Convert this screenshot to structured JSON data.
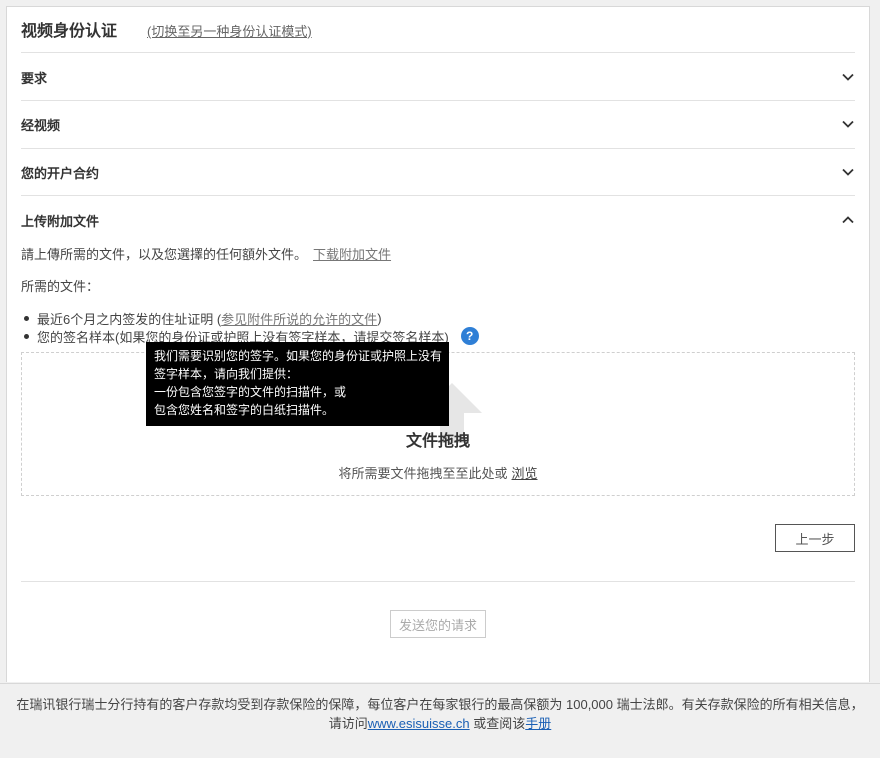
{
  "header": {
    "title": "视频身份认证",
    "switch_link": "(切换至另一种身份认证模式)"
  },
  "sections": [
    {
      "label": "要求",
      "state": "collapsed"
    },
    {
      "label": "经视频",
      "state": "collapsed"
    },
    {
      "label": "您的开户合约",
      "state": "collapsed"
    },
    {
      "label": "上传附加文件",
      "state": "expanded"
    }
  ],
  "upload": {
    "intro": "請上傳所需的文件，以及您選擇的任何額外文件。",
    "download_link": "下载附加文件",
    "required_label": "所需的文件：",
    "item1_text": "最近6个月之内签发的住址证明 (",
    "item1_link": "参见附件所说的允许的文件",
    "item1_close": ")",
    "item2_text": "您的签名样本(如果您的身份证或护照上没有签字样本，请提交签名样本)",
    "help_icon": "?",
    "dropzone_title": "文件拖拽",
    "dropzone_text": "将所需要文件拖拽至至此处或",
    "browse_link": "浏览"
  },
  "tooltip": {
    "lines": [
      "我们需要识别您的签字。如果您的身份证或护照上没有",
      "签字样本，请向我们提供：",
      "一份包含您签字的文件的扫描件，或",
      "包含您姓名和签字的白纸扫描件。"
    ]
  },
  "buttons": {
    "back": "上一步",
    "send": "发送您的请求"
  },
  "footer": {
    "line1": "在瑞讯银行瑞士分行持有的客户存款均受到存款保险的保障，每位客户在每家银行的最高保额为 100,000 瑞士法郎。有关存款保险的所有相关信息，",
    "line2_prefix": "请访问",
    "site_link": "www.esisuisse.ch",
    "line2_middle": " 或查阅该",
    "manual_link": "手册"
  },
  "icons": {
    "collapsed": "chevron-down-icon",
    "expanded": "chevron-up-icon",
    "upload": "upload-arrow-icon",
    "help": "question-mark-icon"
  },
  "colors": {
    "accent": "#2f7fd6",
    "tooltip_bg": "#000000",
    "link": "#1a5fb4"
  }
}
